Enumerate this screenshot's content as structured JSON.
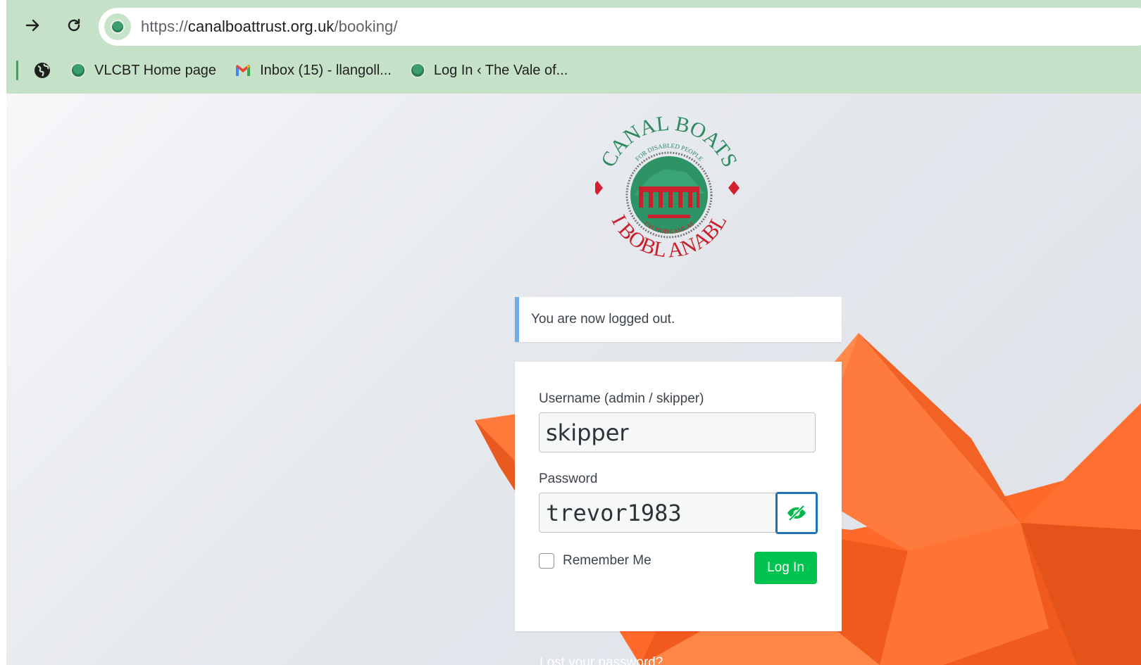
{
  "browser": {
    "url_scheme": "https://",
    "url_host": "canalboattrust.org.uk",
    "url_path": "/booking/",
    "forward_icon": "arrow-right",
    "reload_icon": "reload",
    "bookmarks": [
      {
        "label": "VLCBT Home page",
        "icon": "site-favicon"
      },
      {
        "label": "Inbox (15) - llangoll...",
        "icon": "gmail-icon"
      },
      {
        "label": "Log In ‹ The Vale of...",
        "icon": "site-favicon"
      }
    ]
  },
  "logo": {
    "top_text": "CANAL BOATS",
    "inner_top_text": "FOR DISABLED PEOPLE",
    "inner_bottom_text": "CYCHOD CAMLAS",
    "bottom_text": "I BOBL ANABL"
  },
  "notice": {
    "message": "You are now logged out."
  },
  "login": {
    "username_label": "Username (admin / skipper)",
    "username_value": "skipper",
    "password_label": "Password",
    "password_value": "trevor1983",
    "show_password_icon": "eye-slash-icon",
    "remember_label": "Remember Me",
    "remember_checked": false,
    "submit_label": "Log In",
    "lost_password": "Lost your password?"
  },
  "colors": {
    "chrome_bg": "#c5e2c8",
    "notice_accent": "#72aee6",
    "button_green": "#00c44f",
    "focus_blue": "#2271b1",
    "boat_orange": "#ff6a2b"
  }
}
